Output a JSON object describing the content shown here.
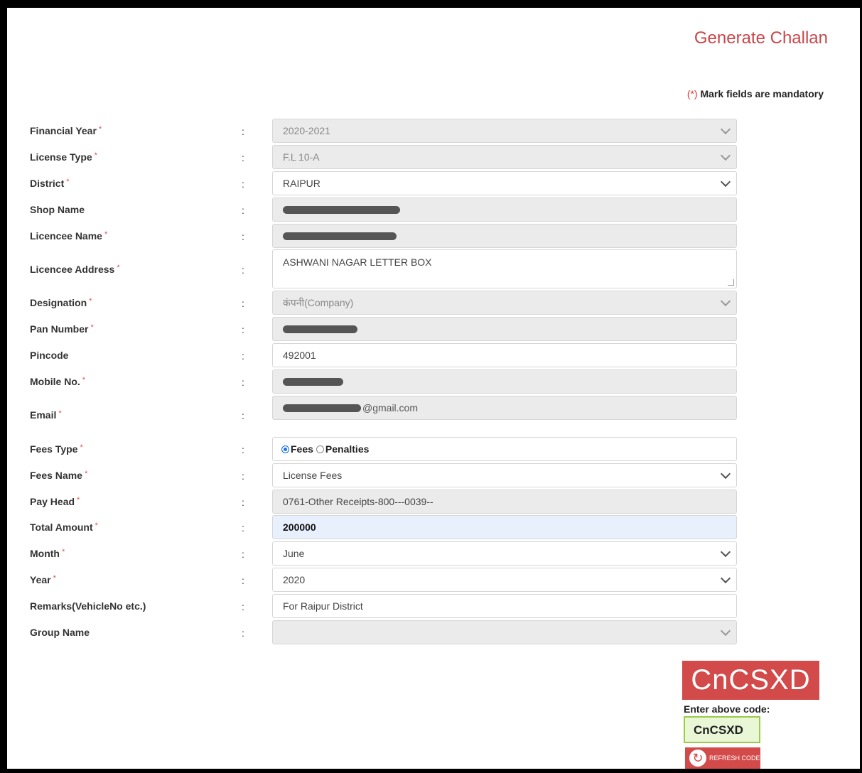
{
  "header": {
    "title": "Generate Challan",
    "mandatory_star": "(*)",
    "mandatory_text": "Mark fields are mandatory"
  },
  "colon": ":",
  "fields": {
    "financial_year": {
      "label": "Financial Year",
      "value": "2020-2021"
    },
    "license_type": {
      "label": "License Type",
      "value": "F.L 10-A"
    },
    "district": {
      "label": "District",
      "value": "RAIPUR"
    },
    "shop_name": {
      "label": "Shop Name"
    },
    "licencee_name": {
      "label": "Licencee Name"
    },
    "licencee_address": {
      "label": "Licencee Address",
      "value": "ASHWANI NAGAR LETTER BOX"
    },
    "designation": {
      "label": "Designation",
      "value": "कंपनी(Company)"
    },
    "pan_number": {
      "label": "Pan Number"
    },
    "pincode": {
      "label": "Pincode",
      "value": "492001"
    },
    "mobile_no": {
      "label": "Mobile No."
    },
    "email": {
      "label": "Email",
      "value_suffix": "@gmail.com"
    },
    "fees_type": {
      "label": "Fees Type",
      "option_fees": "Fees",
      "option_penalties": "Penalties"
    },
    "fees_name": {
      "label": "Fees Name",
      "value": "License Fees"
    },
    "pay_head": {
      "label": "Pay Head",
      "value": "0761-Other Receipts-800---0039--"
    },
    "total_amount": {
      "label": "Total Amount",
      "value": "200000"
    },
    "month": {
      "label": "Month",
      "value": "June"
    },
    "year": {
      "label": "Year",
      "value": "2020"
    },
    "remarks": {
      "label": "Remarks(VehicleNo etc.)",
      "value": "For Raipur District"
    },
    "group_name": {
      "label": "Group Name",
      "value": ""
    }
  },
  "captcha": {
    "code": "CnCSXD",
    "prompt": "Enter above code:",
    "input_value": "CnCSXD",
    "refresh_label": "REFRESH CODE"
  },
  "icons": [
    "chevron-down-icon",
    "refresh-icon"
  ]
}
